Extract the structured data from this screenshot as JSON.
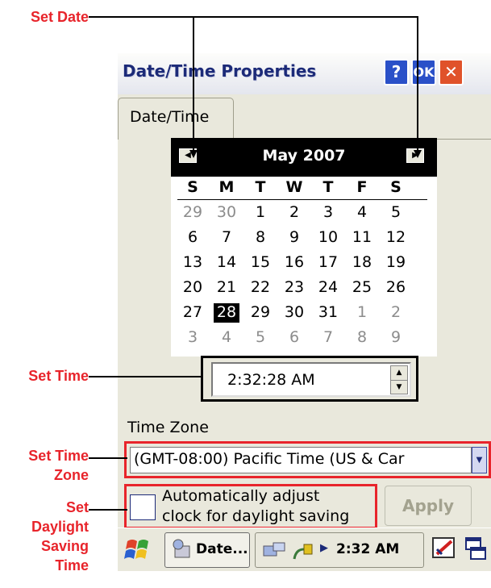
{
  "callouts": {
    "set_date": "Set Date",
    "set_time": "Set Time",
    "set_time_zone_line1": "Set Time",
    "set_time_zone_line2": "Zone",
    "set_dst_line1": "Set",
    "set_dst_line2": "Daylight",
    "set_dst_line3": "Saving",
    "set_dst_line4": "Time"
  },
  "window": {
    "title": "Date/Time Properties",
    "help_label": "?",
    "ok_label": "OK",
    "close_label": "✕"
  },
  "tab": {
    "label": "Date/Time"
  },
  "calendar": {
    "month_label": "May 2007",
    "prev_icon": "◀",
    "next_icon": "▶",
    "weekdays": [
      "S",
      "M",
      "T",
      "W",
      "T",
      "F",
      "S"
    ],
    "weeks": [
      [
        {
          "d": "29",
          "o": true
        },
        {
          "d": "30",
          "o": true
        },
        {
          "d": "1"
        },
        {
          "d": "2"
        },
        {
          "d": "3"
        },
        {
          "d": "4"
        },
        {
          "d": "5"
        }
      ],
      [
        {
          "d": "6"
        },
        {
          "d": "7"
        },
        {
          "d": "8"
        },
        {
          "d": "9"
        },
        {
          "d": "10"
        },
        {
          "d": "11"
        },
        {
          "d": "12"
        }
      ],
      [
        {
          "d": "13"
        },
        {
          "d": "14"
        },
        {
          "d": "15"
        },
        {
          "d": "16"
        },
        {
          "d": "17"
        },
        {
          "d": "18"
        },
        {
          "d": "19"
        }
      ],
      [
        {
          "d": "20"
        },
        {
          "d": "21"
        },
        {
          "d": "22"
        },
        {
          "d": "23"
        },
        {
          "d": "24"
        },
        {
          "d": "25"
        },
        {
          "d": "26"
        }
      ],
      [
        {
          "d": "27"
        },
        {
          "d": "28",
          "sel": true
        },
        {
          "d": "29"
        },
        {
          "d": "30"
        },
        {
          "d": "31"
        },
        {
          "d": "1",
          "o": true
        },
        {
          "d": "2",
          "o": true
        }
      ],
      [
        {
          "d": "3",
          "o": true
        },
        {
          "d": "4",
          "o": true
        },
        {
          "d": "5",
          "o": true
        },
        {
          "d": "6",
          "o": true
        },
        {
          "d": "7",
          "o": true
        },
        {
          "d": "8",
          "o": true
        },
        {
          "d": "9",
          "o": true
        }
      ]
    ]
  },
  "time": {
    "value": "2:32:28 AM",
    "spin_up": "▲",
    "spin_down": "▼"
  },
  "timezone": {
    "label": "Time Zone",
    "value": "(GMT-08:00) Pacific Time (US & Car",
    "dropdown_icon": "▼"
  },
  "dst": {
    "line1": "Automatically adjust",
    "line2": "clock for daylight saving"
  },
  "apply_label": "Apply",
  "taskbar": {
    "start_icon": "windows-flag-icon",
    "task_label": "Date...",
    "clock": "2:32 AM",
    "tray_arrow": "▶"
  },
  "colors": {
    "callout": "#e8242b",
    "title_bar_text": "#1c2a78"
  }
}
